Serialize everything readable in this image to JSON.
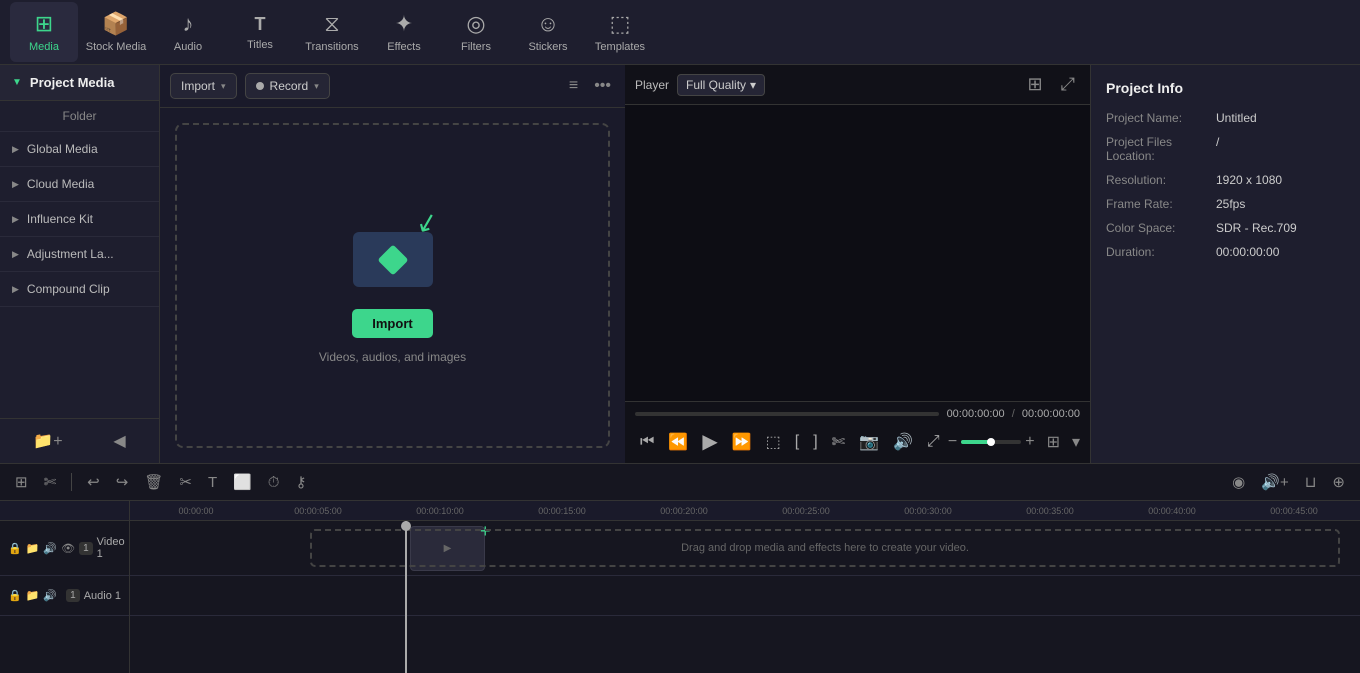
{
  "topNav": {
    "items": [
      {
        "id": "media",
        "label": "Media",
        "icon": "⊞",
        "active": true
      },
      {
        "id": "stock-media",
        "label": "Stock Media",
        "icon": "📦"
      },
      {
        "id": "audio",
        "label": "Audio",
        "icon": "♪"
      },
      {
        "id": "titles",
        "label": "Titles",
        "icon": "T"
      },
      {
        "id": "transitions",
        "label": "Transitions",
        "icon": "⧖"
      },
      {
        "id": "effects",
        "label": "Effects",
        "icon": "✦"
      },
      {
        "id": "filters",
        "label": "Filters",
        "icon": "◎"
      },
      {
        "id": "stickers",
        "label": "Stickers",
        "icon": "☺"
      },
      {
        "id": "templates",
        "label": "Templates",
        "icon": "⬚"
      }
    ]
  },
  "sidebar": {
    "header": "Project Media",
    "folderLabel": "Folder",
    "items": [
      {
        "label": "Global Media"
      },
      {
        "label": "Cloud Media"
      },
      {
        "label": "Influence Kit"
      },
      {
        "label": "Adjustment La..."
      },
      {
        "label": "Compound Clip"
      }
    ],
    "bottomIcons": [
      "add-folder",
      "add-media"
    ]
  },
  "mediaPanel": {
    "importLabel": "Import",
    "recordLabel": "Record",
    "importBoxText": "Videos, audios, and images",
    "importBtnLabel": "Import"
  },
  "player": {
    "label": "Player",
    "quality": "Full Quality",
    "currentTime": "00:00:00:00",
    "totalTime": "00:00:00:00"
  },
  "projectInfo": {
    "title": "Project Info",
    "fields": [
      {
        "label": "Project Name:",
        "value": "Untitled"
      },
      {
        "label": "Project Files Location:",
        "value": "/"
      },
      {
        "label": "Resolution:",
        "value": "1920 x 1080"
      },
      {
        "label": "Frame Rate:",
        "value": "25fps"
      },
      {
        "label": "Color Space:",
        "value": "SDR - Rec.709"
      },
      {
        "label": "Duration:",
        "value": "00:00:00:00"
      }
    ]
  },
  "timeline": {
    "rulerMarks": [
      "00:00:00",
      "00:00:05:00",
      "00:00:10:00",
      "00:00:15:00",
      "00:00:20:00",
      "00:00:25:00",
      "00:00:30:00",
      "00:00:35:00",
      "00:00:40:00",
      "00:00:45:00"
    ],
    "tracks": [
      {
        "id": "video1",
        "badge": "1",
        "label": "Video 1",
        "type": "video"
      },
      {
        "id": "audio1",
        "badge": "1",
        "label": "Audio 1",
        "type": "audio"
      }
    ],
    "dropText": "Drag and drop media and effects here to create your video."
  }
}
